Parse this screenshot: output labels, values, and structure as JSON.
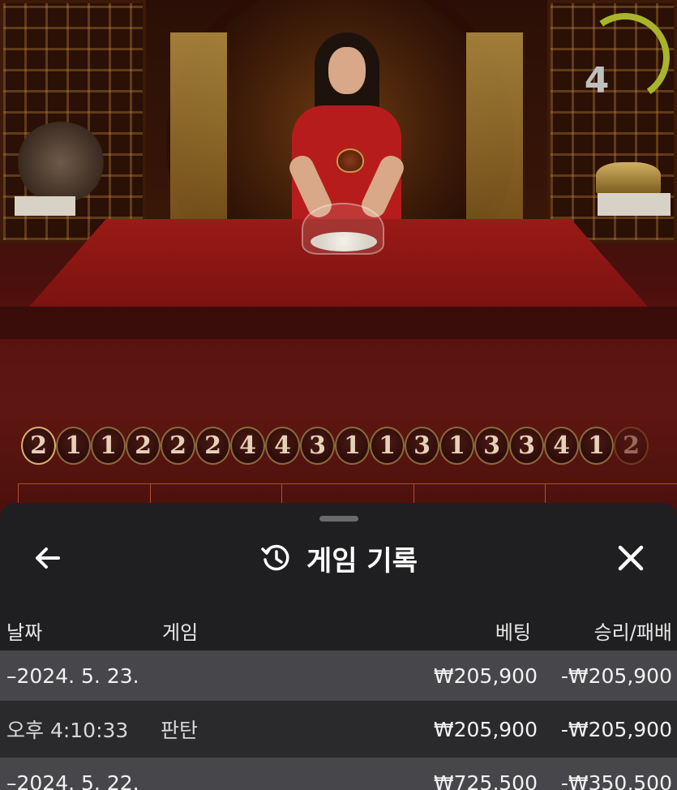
{
  "timer": {
    "value": "4",
    "color": "#a8b52a"
  },
  "history_beads": [
    "2",
    "1",
    "1",
    "2",
    "2",
    "2",
    "4",
    "4",
    "3",
    "1",
    "1",
    "3",
    "1",
    "3",
    "3",
    "4",
    "1",
    "2"
  ],
  "sheet": {
    "title": "게임 기록",
    "back_icon": "arrow-left-icon",
    "history_icon": "history-clock-icon",
    "close_icon": "close-icon",
    "columns": {
      "date": "날짜",
      "game": "게임",
      "bet": "베팅",
      "result": "승리/패배"
    },
    "rows": [
      {
        "type": "date",
        "date": "–2024. 5. 23.",
        "game": "",
        "bet": "₩205,900",
        "result": "-₩205,900"
      },
      {
        "type": "entry",
        "date": "오후 4:10:33",
        "game": "판탄",
        "bet": "₩205,900",
        "result": "-₩205,900"
      },
      {
        "type": "date",
        "date": "–2024. 5. 22.",
        "game": "",
        "bet": "₩725,500",
        "result": "-₩350,500"
      }
    ]
  }
}
